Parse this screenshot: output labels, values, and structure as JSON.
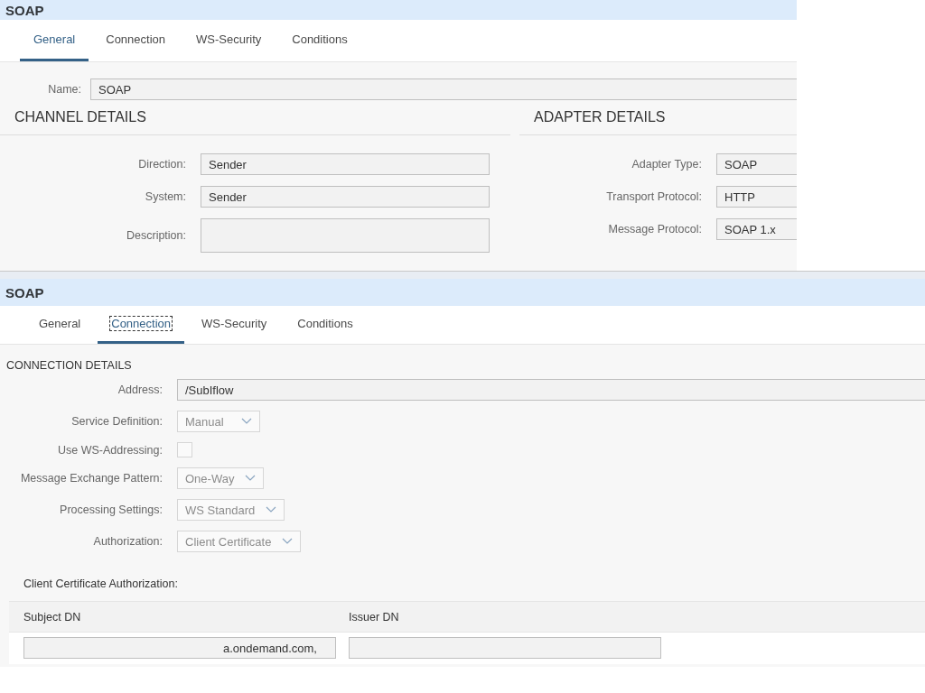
{
  "panels": [
    {
      "kind": "general",
      "title": "SOAP",
      "tabs": [
        {
          "label": "General",
          "selected": true,
          "focused": false
        },
        {
          "label": "Connection",
          "selected": false,
          "focused": false
        },
        {
          "label": "WS-Security",
          "selected": false,
          "focused": false
        },
        {
          "label": "Conditions",
          "selected": false,
          "focused": false
        }
      ],
      "name_field": {
        "label": "Name:",
        "value": "SOAP"
      },
      "sections": [
        {
          "heading": "CHANNEL DETAILS",
          "fields": [
            {
              "kind": "text",
              "label": "Direction:",
              "value": "Sender"
            },
            {
              "kind": "text",
              "label": "System:",
              "value": "Sender"
            },
            {
              "kind": "textarea",
              "label": "Description:"
            }
          ]
        },
        {
          "heading": "ADAPTER DETAILS",
          "fields": [
            {
              "kind": "text",
              "label": "Adapter Type:",
              "value": "SOAP"
            },
            {
              "kind": "text",
              "label": "Transport Protocol:",
              "value": "HTTP"
            },
            {
              "kind": "text",
              "label": "Message Protocol:",
              "value": "SOAP 1.x"
            }
          ]
        }
      ]
    },
    {
      "kind": "connection",
      "title": "SOAP",
      "tabs": [
        {
          "label": "General",
          "selected": false,
          "focused": false
        },
        {
          "label": "Connection",
          "selected": true,
          "focused": true
        },
        {
          "label": "WS-Security",
          "selected": false,
          "focused": false
        },
        {
          "label": "Conditions",
          "selected": false,
          "focused": false
        }
      ],
      "heading": "CONNECTION DETAILS",
      "fields": [
        {
          "kind": "wide",
          "label": "Address:",
          "value": "/SubIflow"
        },
        {
          "kind": "select",
          "label": "Service Definition:",
          "value": "Manual"
        },
        {
          "kind": "checkbox",
          "label": "Use WS-Addressing:",
          "checked": false
        },
        {
          "kind": "select",
          "label": "Message Exchange Pattern:",
          "value": "One-Way"
        },
        {
          "kind": "select",
          "label": "Processing Settings:",
          "value": "WS Standard"
        },
        {
          "kind": "select",
          "label": "Authorization:",
          "value": "Client Certificate"
        }
      ],
      "table": {
        "title": "Client Certificate Authorization:",
        "columns": [
          "Subject DN",
          "Issuer DN"
        ],
        "rows": [
          [
            "a.ondemand.com,"
          ]
        ]
      }
    }
  ]
}
